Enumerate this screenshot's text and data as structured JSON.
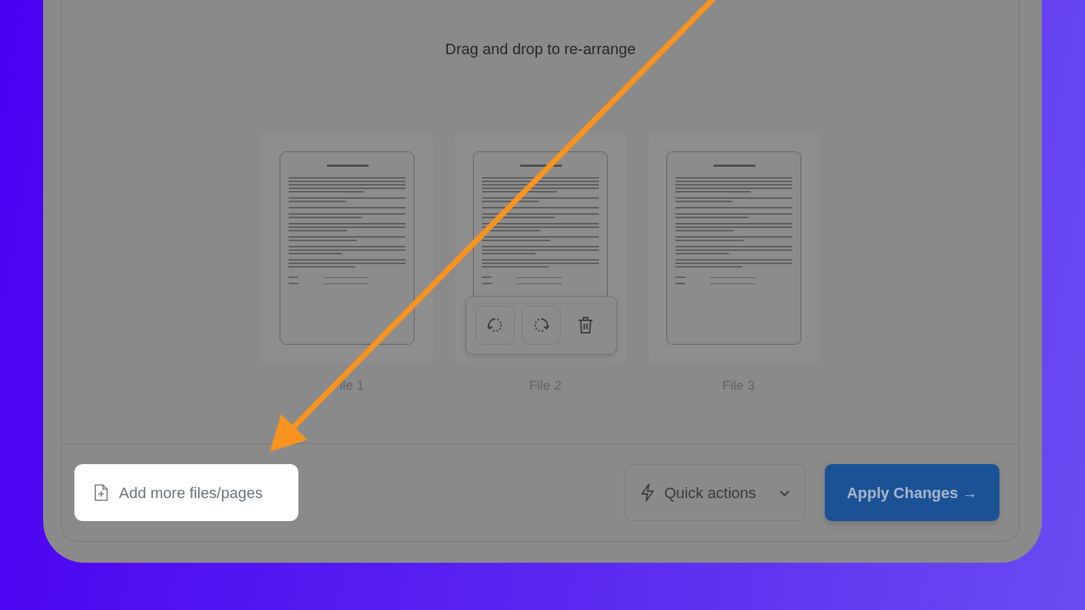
{
  "instruction": "Drag and drop to re-arrange",
  "files": [
    {
      "label": "ile 1",
      "hovered": false
    },
    {
      "label": "File 2",
      "hovered": true
    },
    {
      "label": "File 3",
      "hovered": false
    }
  ],
  "add_button": {
    "label": "Add more files/pages",
    "highlighted": true
  },
  "quick_actions": {
    "label": "Quick actions"
  },
  "apply_button": {
    "label": "Apply Changes →"
  }
}
